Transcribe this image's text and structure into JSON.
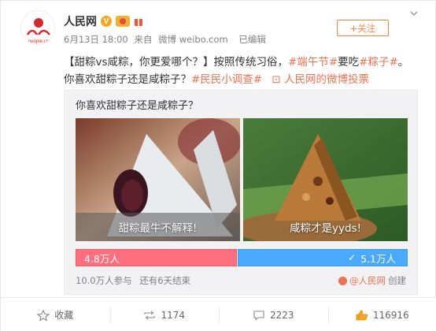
{
  "account": {
    "name": "人民网",
    "verified_badge": "V",
    "logo_sub": "people.cn"
  },
  "post": {
    "date": "6月13日 18:00",
    "source_prefix": "来自",
    "source": "微博 weibo.com",
    "edited": "已编辑",
    "text_1": "【甜粽vs咸粽，你更爱哪个？】按照传统习俗，",
    "tag_1": "#端午节#",
    "text_2": "要吃",
    "tag_2": "#粽子#",
    "text_3": "。你喜欢甜粽子还是咸粽子？",
    "tag_3": "#民民小调查#",
    "link_icon": "⊡",
    "link_text": "人民网的微博投票"
  },
  "follow_button": "+关注",
  "vote": {
    "question": "你喜欢甜粽子还是咸粽子？",
    "option_left_caption": "甜粽最牛不解释!",
    "option_right_caption": "咸粽才是yyds!",
    "left_count": "4.8万人",
    "right_count": "5.1万人",
    "left_share": 0.485,
    "right_share": 0.515,
    "participants": "10.0万人参与",
    "remaining": "还有6天结束",
    "creator": "@人民网",
    "created_label": "创建"
  },
  "actions": {
    "favorite_label": "收藏",
    "repost_count": "1174",
    "comment_count": "2223",
    "like_count": "116916"
  },
  "colors": {
    "accent": "#ff8140",
    "link": "#eb7350",
    "sweet_bar": "#ff6f7d",
    "salty_bar": "#4aaaff"
  },
  "icons": [
    "people-daily-logo-icon",
    "verified-icon",
    "medal-icon",
    "gift-icon",
    "chevron-down-icon",
    "check-icon",
    "star-icon",
    "repost-icon",
    "comment-icon",
    "like-icon"
  ]
}
